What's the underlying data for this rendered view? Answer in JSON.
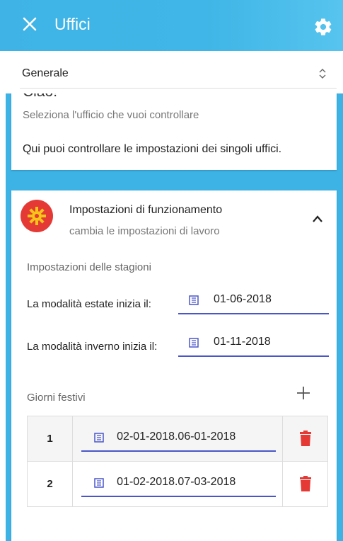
{
  "header": {
    "title": "Uffici",
    "close_icon": "close-icon",
    "settings_icon": "gear-icon"
  },
  "selector": {
    "value": "Generale",
    "icon": "updown-icon"
  },
  "intro_card": {
    "greeting": "Ciao!",
    "subtitle": "Seleziona l'ufficio che vuoi controllare",
    "message": "Qui puoi controllare le impostazioni dei singoli uffici."
  },
  "settings_card": {
    "title": "Impostazioni di funzionamento",
    "subtitle": "cambia le impostazioni di lavoro",
    "seasons": {
      "heading": "Impostazioni delle stagioni",
      "summer_label": "La modalità estate inizia il:",
      "summer_date": "01-06-2018",
      "winter_label": "La modalità inverno inizia il:",
      "winter_date": "01-11-2018"
    },
    "holidays": {
      "heading": "Giorni festivi",
      "rows": [
        {
          "num": "1",
          "range": "02-01-2018.06-01-2018"
        },
        {
          "num": "2",
          "range": "01-02-2018.07-03-2018"
        }
      ]
    }
  },
  "colors": {
    "accent": "#3fb3e6",
    "avatar": "#e53935",
    "underline": "#4a56c8",
    "trash": "#e53935"
  }
}
